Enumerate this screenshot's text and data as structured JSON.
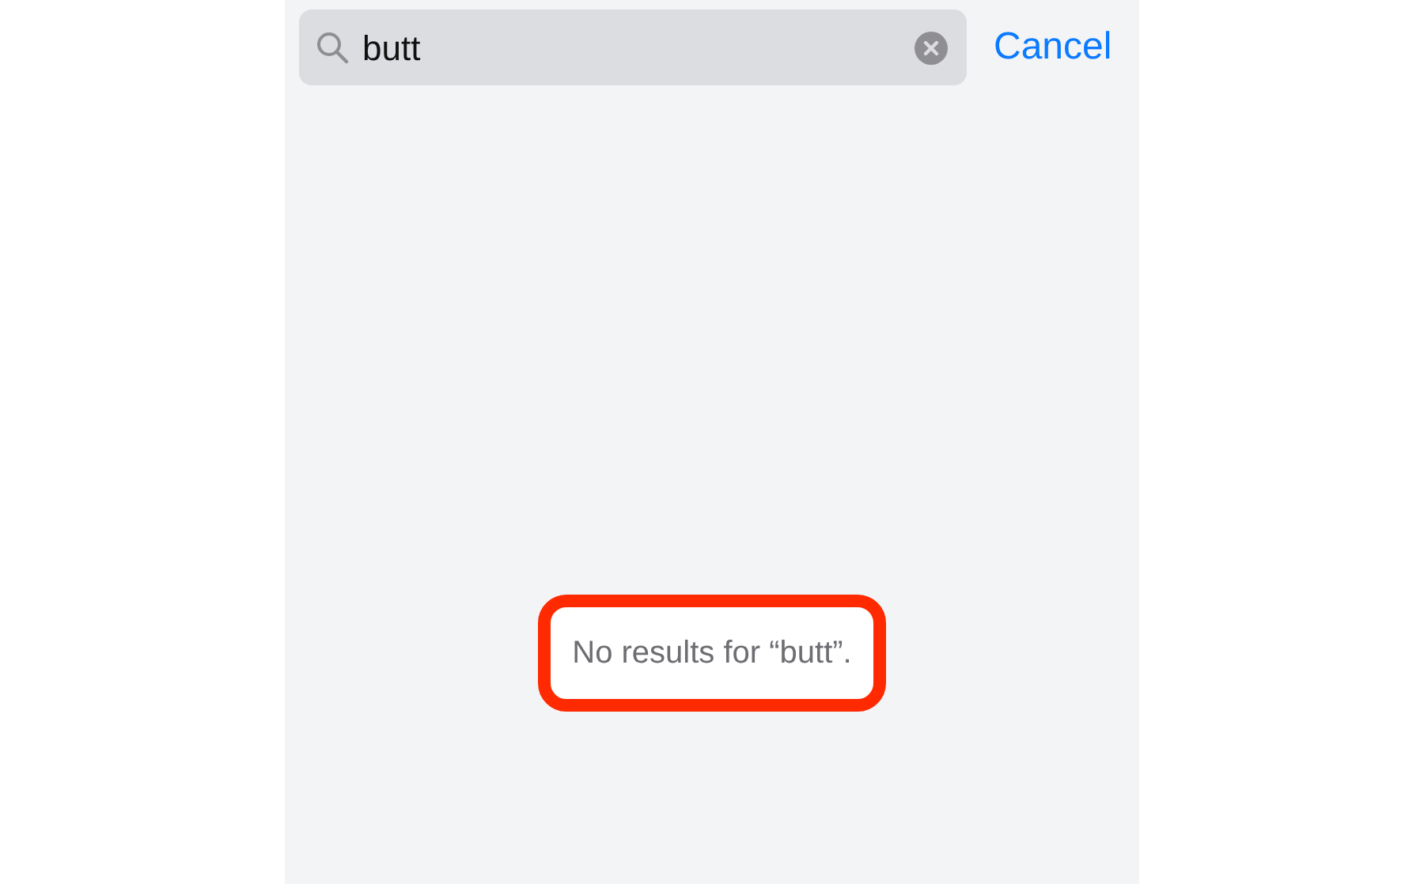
{
  "search": {
    "value": "butt",
    "cancel_label": "Cancel"
  },
  "message": {
    "text": "No results for “butt”.",
    "highlighted": true
  }
}
